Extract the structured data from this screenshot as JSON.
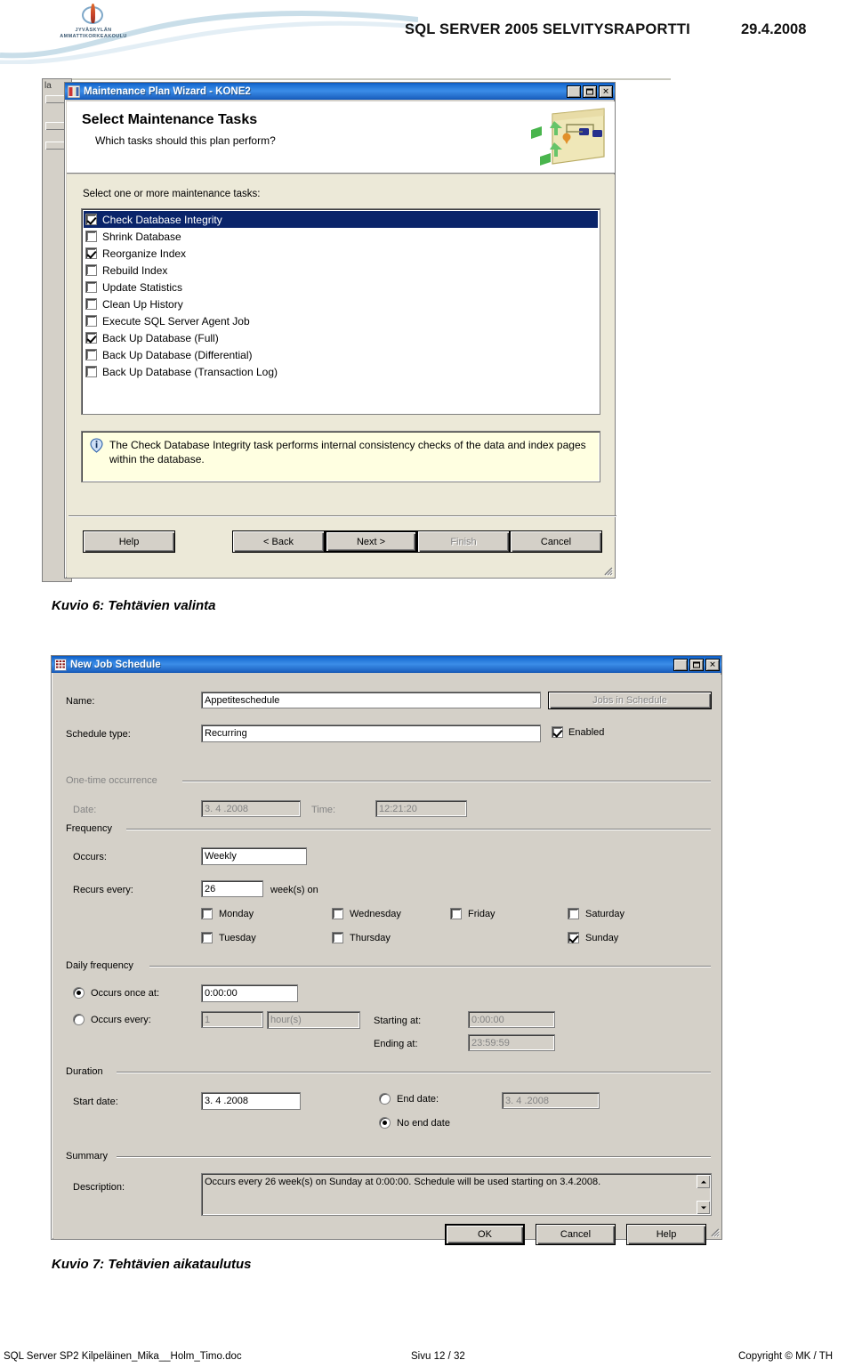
{
  "page_header": {
    "logo_line1": "JYVÄSKYLÄN",
    "logo_line2": "AMMATTIKORKEAKOULU",
    "title": "SQL SERVER 2005 SELVITYSRAPORTTI",
    "date": "29.4.2008"
  },
  "footer": {
    "left": "SQL Server SP2 Kilpeläinen_Mika__Holm_Timo.doc",
    "center": "Sivu 12 / 32",
    "right": "Copyright © MK / TH"
  },
  "captions": {
    "figure6": "Kuvio 6: Tehtävien valinta",
    "figure7": "Kuvio 7: Tehtävien aikataulutus"
  },
  "wizard": {
    "window_title": "Maintenance Plan Wizard - KONE2",
    "heading": "Select Maintenance Tasks",
    "subheading": "Which tasks should this plan perform?",
    "list_label": "Select one or more maintenance tasks:",
    "tasks": [
      {
        "label": "Check Database Integrity",
        "checked": true,
        "selected": true
      },
      {
        "label": "Shrink Database",
        "checked": false,
        "selected": false
      },
      {
        "label": "Reorganize Index",
        "checked": true,
        "selected": false
      },
      {
        "label": "Rebuild Index",
        "checked": false,
        "selected": false
      },
      {
        "label": "Update Statistics",
        "checked": false,
        "selected": false
      },
      {
        "label": "Clean Up History",
        "checked": false,
        "selected": false
      },
      {
        "label": "Execute SQL Server Agent Job",
        "checked": false,
        "selected": false
      },
      {
        "label": "Back Up Database (Full)",
        "checked": true,
        "selected": false
      },
      {
        "label": "Back Up Database (Differential)",
        "checked": false,
        "selected": false
      },
      {
        "label": "Back Up Database (Transaction Log)",
        "checked": false,
        "selected": false
      }
    ],
    "description": "The Check Database Integrity task performs internal consistency checks of the data and index pages within the database.",
    "buttons": {
      "help": "Help",
      "back": "< Back",
      "next": "Next >",
      "finish": "Finish",
      "cancel": "Cancel"
    }
  },
  "schedule": {
    "window_title": "New Job Schedule",
    "name_label": "Name:",
    "name_value": "Appetiteschedule",
    "jobs_in_schedule_button": "Jobs in Schedule",
    "schedule_type_label": "Schedule type:",
    "schedule_type_value": "Recurring",
    "enabled_label": "Enabled",
    "enabled_checked": true,
    "one_time": {
      "group_label": "One-time occurrence",
      "date_label": "Date:",
      "date_value": "3. 4 .2008",
      "time_label": "Time:",
      "time_value": "12:21:20"
    },
    "frequency": {
      "group_label": "Frequency",
      "occurs_label": "Occurs:",
      "occurs_value": "Weekly",
      "recurs_label": "Recurs every:",
      "recurs_value": "26",
      "recurs_unit": "week(s) on",
      "days": [
        {
          "label": "Monday",
          "checked": false
        },
        {
          "label": "Tuesday",
          "checked": false
        },
        {
          "label": "Wednesday",
          "checked": false
        },
        {
          "label": "Thursday",
          "checked": false
        },
        {
          "label": "Friday",
          "checked": false
        },
        {
          "label": "Saturday",
          "checked": false
        },
        {
          "label": "Sunday",
          "checked": true
        }
      ]
    },
    "daily_frequency": {
      "group_label": "Daily frequency",
      "once_at_label": "Occurs once at:",
      "once_at_value": "0:00:00",
      "once_at_selected": true,
      "every_label": "Occurs every:",
      "every_value": "1",
      "every_unit": "hour(s)",
      "starting_at_label": "Starting at:",
      "starting_at_value": "0:00:00",
      "ending_at_label": "Ending at:",
      "ending_at_value": "23:59:59"
    },
    "duration": {
      "group_label": "Duration",
      "start_date_label": "Start date:",
      "start_date_value": "3. 4 .2008",
      "end_date_label": "End date:",
      "end_date_value": "3. 4 .2008",
      "no_end_date_label": "No end date",
      "no_end_date_selected": true
    },
    "summary": {
      "group_label": "Summary",
      "description_label": "Description:",
      "description_value": "Occurs every 26 week(s) on Sunday at 0:00:00. Schedule will be used starting on 3.4.2008."
    },
    "buttons": {
      "ok": "OK",
      "cancel": "Cancel",
      "help": "Help"
    }
  }
}
